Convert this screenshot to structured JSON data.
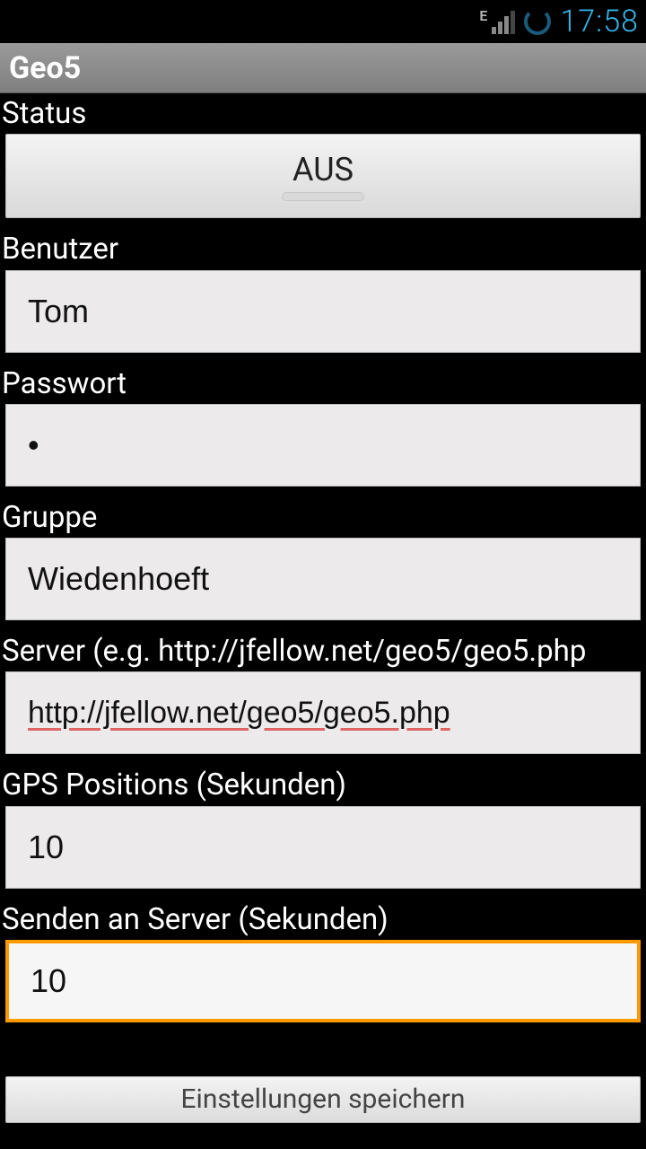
{
  "statusbar": {
    "network_label": "E",
    "clock": "17:58"
  },
  "app": {
    "title": "Geo5"
  },
  "form": {
    "status": {
      "label": "Status",
      "value": "AUS"
    },
    "user": {
      "label": "Benutzer",
      "value": "Tom"
    },
    "password": {
      "label": "Passwort",
      "value": "•"
    },
    "group": {
      "label": "Gruppe",
      "value": "Wiedenhoeft"
    },
    "server": {
      "label": "Server (e.g. http://jfellow.net/geo5/geo5.php",
      "value": "http://jfellow.net/geo5/geo5.php"
    },
    "gps": {
      "label": "GPS Positions (Sekunden)",
      "value": "10"
    },
    "send": {
      "label": "Senden an Server (Sekunden)",
      "value": "10"
    },
    "save_button": "Einstellungen speichern"
  }
}
